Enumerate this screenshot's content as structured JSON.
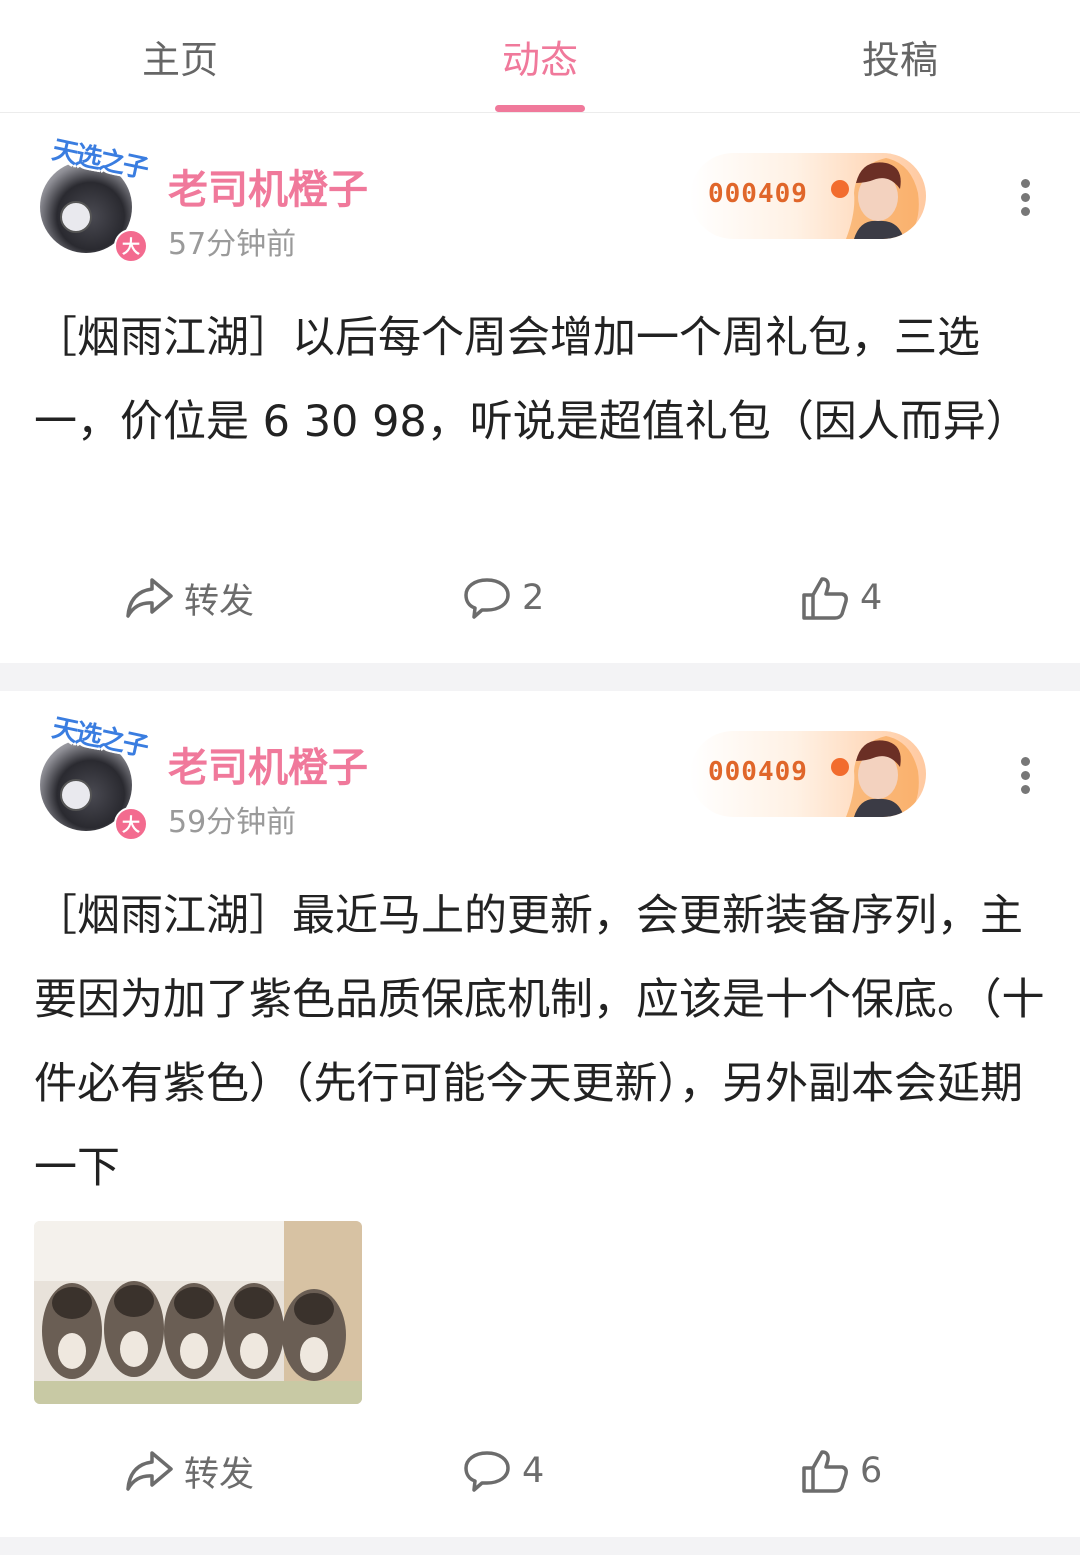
{
  "tabs": {
    "home": "主页",
    "dynamics": "动态",
    "submissions": "投稿"
  },
  "posts": [
    {
      "author": "老司机橙子",
      "time": "57分钟前",
      "fan_badge_number": "000409",
      "avatar_badge": "大",
      "pendant_text": "天选之子",
      "text": "［烟雨江湖］以后每个周会增加一个周礼包，三选一，价位是 6 30 98，听说是超值礼包（因人而异）",
      "actions": {
        "share_label": "转发",
        "comment_count": "2",
        "like_count": "4"
      }
    },
    {
      "author": "老司机橙子",
      "time": "59分钟前",
      "fan_badge_number": "000409",
      "avatar_badge": "大",
      "pendant_text": "天选之子",
      "text": "［烟雨江湖］最近马上的更新，会更新装备序列，主要因为加了紫色品质保底机制，应该是十个保底。（十件必有紫色）（先行可能今天更新），另外副本会延期一下",
      "image": "kittens-photo",
      "actions": {
        "share_label": "转发",
        "comment_count": "4",
        "like_count": "6"
      }
    }
  ],
  "colors": {
    "accent": "#f0799b",
    "fan_number": "#e0662a",
    "muted": "#9a9a9a",
    "separator": "#f3f3f5"
  },
  "icons": [
    "share-icon",
    "comment-icon",
    "like-icon",
    "more-icon"
  ]
}
